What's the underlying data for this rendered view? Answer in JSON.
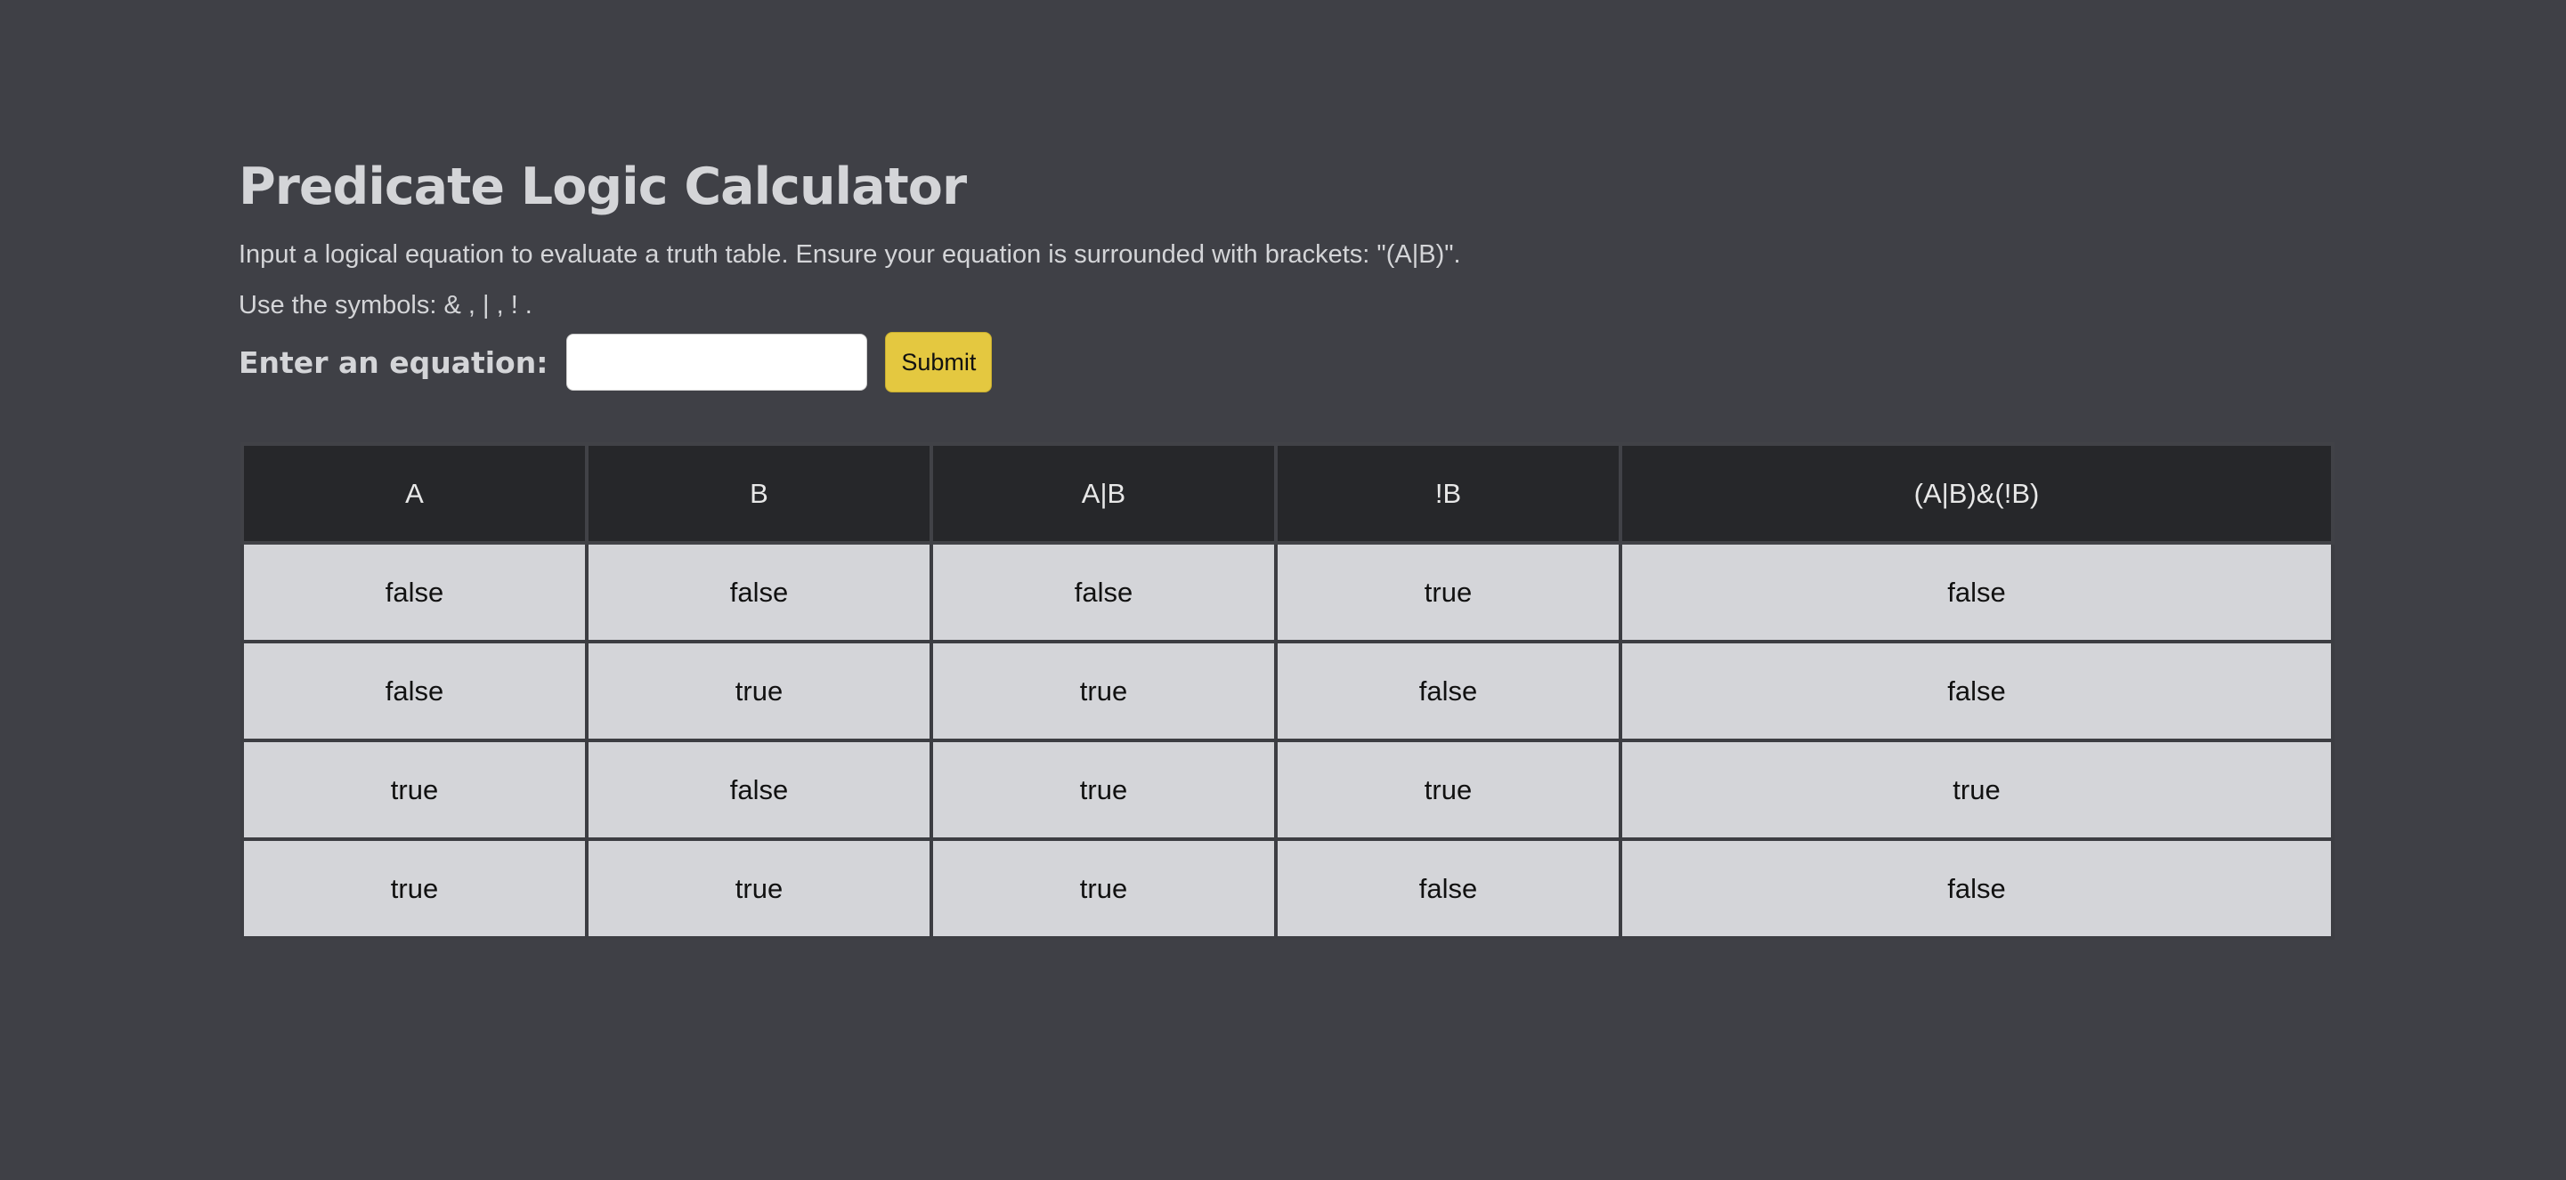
{
  "page": {
    "title": "Predicate Logic Calculator",
    "description_line1": "Input a logical equation to evaluate a truth table. Ensure your equation is surrounded with brackets: \"(A|B)\".",
    "description_line2": "Use the symbols: & , | , ! ."
  },
  "form": {
    "label": "Enter an equation:",
    "input_value": "",
    "input_placeholder": "",
    "submit_label": "Submit"
  },
  "table": {
    "headers": [
      "A",
      "B",
      "A|B",
      "!B",
      "(A|B)&(!B)"
    ],
    "rows": [
      [
        "false",
        "false",
        "false",
        "true",
        "false"
      ],
      [
        "false",
        "true",
        "true",
        "false",
        "false"
      ],
      [
        "true",
        "false",
        "true",
        "true",
        "true"
      ],
      [
        "true",
        "true",
        "true",
        "false",
        "false"
      ]
    ]
  },
  "colors": {
    "background": "#3f4046",
    "header_bg": "#26272a",
    "cell_bg": "#d4d5d9",
    "submit_bg": "#e4c840"
  }
}
